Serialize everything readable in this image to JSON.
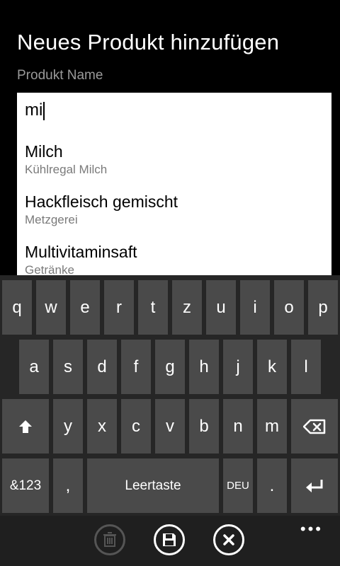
{
  "page": {
    "title": "Neues Produkt hinzufügen",
    "field_label": "Produkt Name"
  },
  "input": {
    "value": "mi"
  },
  "suggestions": [
    {
      "name": "Milch",
      "category": "Kühlregal Milch"
    },
    {
      "name": "Hackfleisch gemischt",
      "category": "Metzgerei"
    },
    {
      "name": "Multivitaminsaft",
      "category": "Getränke"
    }
  ],
  "keyboard": {
    "row1": [
      "q",
      "w",
      "e",
      "r",
      "t",
      "z",
      "u",
      "i",
      "o",
      "p"
    ],
    "row2": [
      "a",
      "s",
      "d",
      "f",
      "g",
      "h",
      "j",
      "k",
      "l"
    ],
    "row3": [
      "y",
      "x",
      "c",
      "v",
      "b",
      "n",
      "m"
    ],
    "symbols_label": "&123",
    "comma": ",",
    "space_label": "Leertaste",
    "language_label": "DEU",
    "period": "."
  },
  "appbar": {
    "more_label": "•••"
  },
  "colors": {
    "background": "#000000",
    "key": "#4a4a4a",
    "keyboard_bg": "#262626"
  }
}
